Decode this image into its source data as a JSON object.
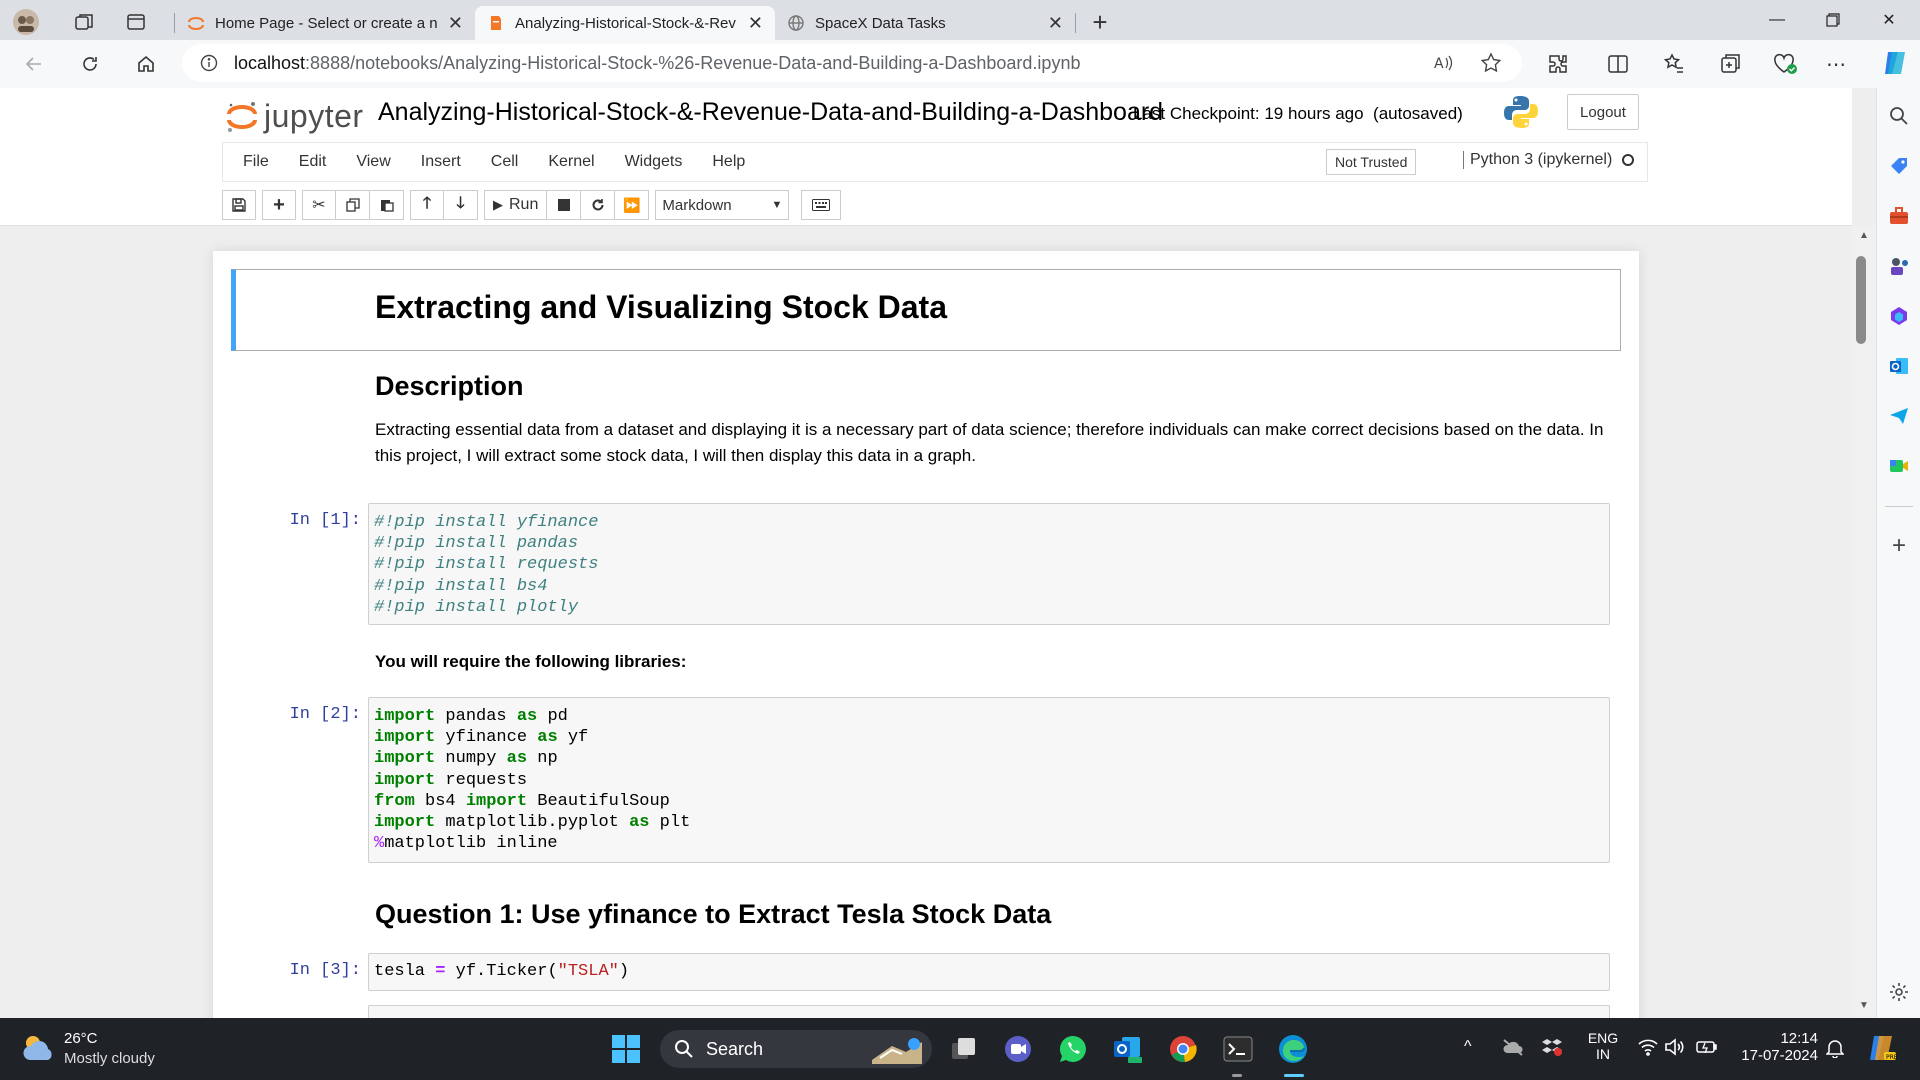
{
  "browser": {
    "tabs": [
      {
        "title": "Home Page - Select or create a n",
        "active": false
      },
      {
        "title": "Analyzing-Historical-Stock-&-Rev",
        "active": true
      },
      {
        "title": "SpaceX Data Tasks",
        "active": false
      }
    ],
    "address": {
      "host": "localhost",
      "rest": ":8888/notebooks/Analyzing-Historical-Stock-%26-Revenue-Data-and-Building-a-Dashboard.ipynb"
    }
  },
  "jupyter": {
    "logo_text": "jupyter",
    "notebook_title": "Analyzing-Historical-Stock-&-Revenue-Data-and-Building-a-Dashboard",
    "checkpoint": "Last Checkpoint: 19 hours ago  (autosaved)",
    "logout_label": "Logout",
    "menus": [
      "File",
      "Edit",
      "View",
      "Insert",
      "Cell",
      "Kernel",
      "Widgets",
      "Help"
    ],
    "trust_label": "Not Trusted",
    "kernel_label": "Python 3 (ipykernel)",
    "run_label": "Run",
    "cell_type": "Markdown"
  },
  "notebook": {
    "heading": "Extracting and Visualizing Stock Data",
    "description_heading": "Description",
    "description_text": "Extracting essential data from a dataset and displaying it is a necessary part of data science; therefore individuals can make correct decisions based on the data. In this project, I will extract some stock data, I will then display this data in a graph.",
    "cells": [
      {
        "prompt": "In [1]:",
        "lines": [
          "#!pip install yfinance",
          "#!pip install pandas",
          "#!pip install requests",
          "#!pip install bs4",
          "#!pip install plotly"
        ]
      },
      {
        "prompt": "In [2]:",
        "lines": [
          "import pandas as pd",
          "import yfinance as yf",
          "import numpy as np",
          "import requests",
          "from bs4 import BeautifulSoup",
          "import matplotlib.pyplot as plt",
          "%matplotlib inline"
        ]
      },
      {
        "prompt": "In [3]:",
        "lines": [
          "tesla = yf.Ticker(\"TSLA\")"
        ]
      }
    ],
    "libraries_note": "You will require the following libraries:",
    "question1": "Question 1: Use yfinance to Extract Tesla Stock Data"
  },
  "taskbar": {
    "weather_temp": "26°C",
    "weather_desc": "Mostly cloudy",
    "search_label": "Search",
    "lang_top": "ENG",
    "lang_bottom": "IN",
    "time": "12:14",
    "date": "17-07-2024"
  },
  "colors": {
    "accent": "#42a5f5",
    "jupyter_orange": "#f37726",
    "prompt": "#303f9f",
    "keyword": "#008000",
    "comment": "#408080",
    "string": "#ba2121"
  }
}
